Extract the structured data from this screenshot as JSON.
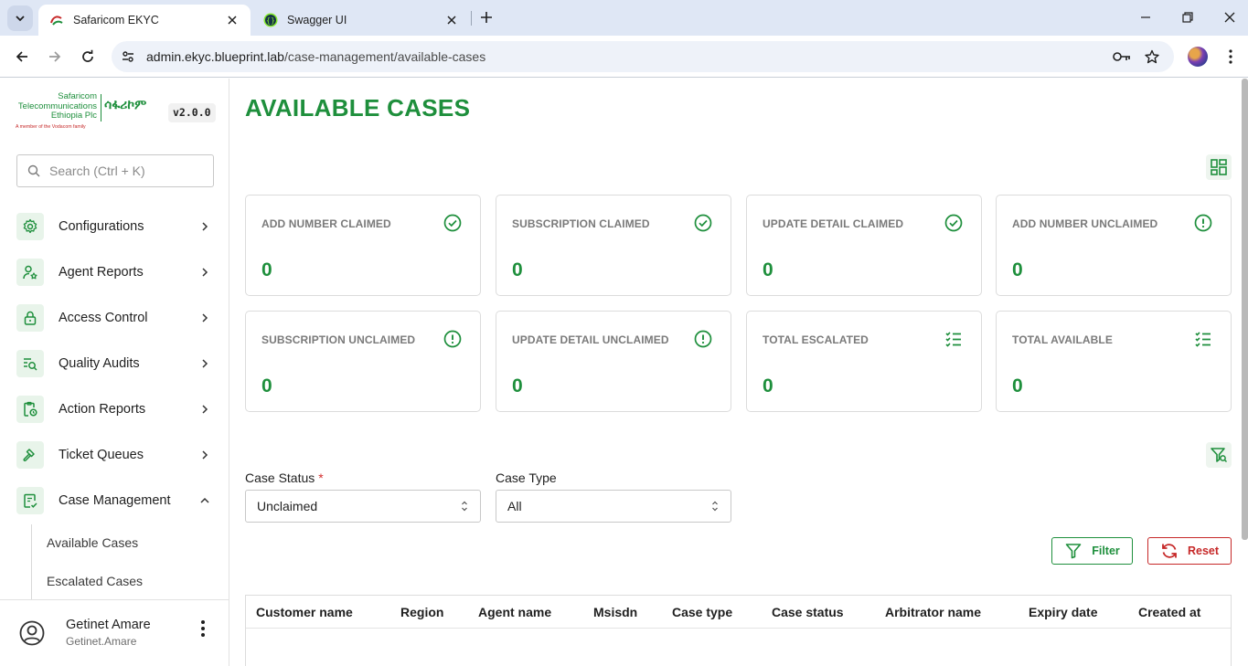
{
  "browser": {
    "tabs": [
      {
        "title": "Safaricom EKYC",
        "active": true
      },
      {
        "title": "Swagger UI",
        "active": false
      }
    ],
    "url_host": "admin.ekyc.blueprint.lab",
    "url_path": "/case-management/available-cases"
  },
  "brand": {
    "logo_line1": "Safaricom",
    "logo_line2": "Telecommunications",
    "logo_line3": "Ethiopia Plc",
    "logo_amharic": "ሳፋሪኮም",
    "logo_tagline": "A member of the Vodacom family",
    "version": "v2.0.0",
    "accent_color": "#1e8f3c"
  },
  "sidebar": {
    "search_placeholder": "Search (Ctrl + K)",
    "items": [
      {
        "label": "Configurations",
        "icon": "gear-icon",
        "expanded": false
      },
      {
        "label": "Agent Reports",
        "icon": "user-star-icon",
        "expanded": false
      },
      {
        "label": "Access Control",
        "icon": "lock-icon",
        "expanded": false
      },
      {
        "label": "Quality Audits",
        "icon": "list-search-icon",
        "expanded": false
      },
      {
        "label": "Action Reports",
        "icon": "clipboard-clock-icon",
        "expanded": false
      },
      {
        "label": "Ticket Queues",
        "icon": "gavel-icon",
        "expanded": false
      },
      {
        "label": "Case Management",
        "icon": "clipboard-check-icon",
        "expanded": true
      }
    ],
    "subitems": [
      {
        "label": "Available Cases"
      },
      {
        "label": "Escalated Cases"
      }
    ],
    "user": {
      "name": "Getinet Amare",
      "login": "Getinet.Amare"
    }
  },
  "main": {
    "title": "AVAILABLE CASES",
    "cards": [
      {
        "label": "ADD NUMBER CLAIMED",
        "value": "0",
        "icon": "check-circle-icon"
      },
      {
        "label": "SUBSCRIPTION CLAIMED",
        "value": "0",
        "icon": "check-circle-icon"
      },
      {
        "label": "UPDATE DETAIL CLAIMED",
        "value": "0",
        "icon": "check-circle-icon"
      },
      {
        "label": "ADD NUMBER UNCLAIMED",
        "value": "0",
        "icon": "alert-circle-icon"
      },
      {
        "label": "SUBSCRIPTION UNCLAIMED",
        "value": "0",
        "icon": "alert-circle-icon"
      },
      {
        "label": "UPDATE DETAIL UNCLAIMED",
        "value": "0",
        "icon": "alert-circle-icon"
      },
      {
        "label": "TOTAL ESCALATED",
        "value": "0",
        "icon": "checklist-icon"
      },
      {
        "label": "TOTAL AVAILABLE",
        "value": "0",
        "icon": "checklist-icon"
      }
    ],
    "filters": {
      "case_status_label": "Case Status",
      "case_status_required": "*",
      "case_status_value": "Unclaimed",
      "case_type_label": "Case Type",
      "case_type_value": "All",
      "filter_button": "Filter",
      "reset_button": "Reset"
    },
    "table": {
      "columns": [
        "Customer name",
        "Region",
        "Agent name",
        "Msisdn",
        "Case type",
        "Case status",
        "Arbitrator name",
        "Expiry date",
        "Created at"
      ],
      "rows": []
    }
  }
}
